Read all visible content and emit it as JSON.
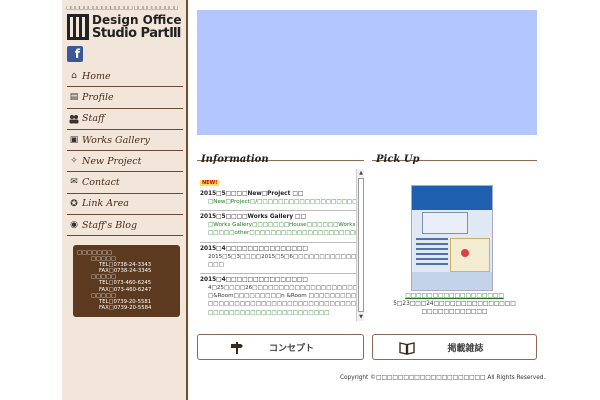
{
  "sidebar": {
    "tagline": "□□□□□□□□□□□□□□□ □□□□□□□□□□",
    "logo_line1": "Design Office",
    "logo_line2": "Studio PartⅢ",
    "facebook_label": "f",
    "nav": [
      {
        "label": "Home",
        "icon": "home-icon",
        "glyph": "⌂"
      },
      {
        "label": "Profile",
        "icon": "profile-card-icon",
        "glyph": "▤"
      },
      {
        "label": "Staff",
        "icon": "people-icon",
        "glyph": "👥"
      },
      {
        "label": "Works Gallery",
        "icon": "gallery-icon",
        "glyph": "▣"
      },
      {
        "label": "New Project",
        "icon": "magic-wand-icon",
        "glyph": "✧"
      },
      {
        "label": "Contact",
        "icon": "mail-icon",
        "glyph": "✉"
      },
      {
        "label": "Link Area",
        "icon": "ribbon-icon",
        "glyph": "✪"
      },
      {
        "label": "Staff's Blog",
        "icon": "rss-icon",
        "glyph": "◉"
      }
    ],
    "address": {
      "heading": "□□□□□□□",
      "office1": "□□□□□",
      "tel1": "TEL□0738-24-3343",
      "fax1": "FAX□0738-24-3345",
      "office2": "□□□□□",
      "tel2": "TEL□073-460-6245",
      "fax2": "FAX□073-460-6247",
      "office3": "□□□□□",
      "tel3": "TEL□0739-20-5581",
      "fax3": "FAX□0739-20-5584"
    }
  },
  "info": {
    "heading": "Information",
    "new_badge": "NEW!",
    "entries": [
      {
        "title": "2015□5□□□□New□Project □□",
        "lines": [
          "□New□Project□/□□□□□□□□□□□□□□□□□□□□□□□□□□□□"
        ]
      },
      {
        "title": "2015□5□□□□Works Gallery □□",
        "lines": [
          "□Works Gallery□□□□□□□House□□□□□□Works Gallery□□",
          "□□□□□other□□□□□□□□□□□□□□□□□□□□□□□□□□□□□□□□"
        ]
      },
      {
        "title": "2015□4□□□□□□□□□□□□□□□",
        "lines": [
          "2015□5□3□□□□2015□5□6□□□□□□□□□□□□□□□□□□□□□□□",
          "□□□"
        ]
      },
      {
        "title": "2015□4□□□□□□□□□□□□□□□",
        "lines": [
          "4□25□□□□26□□□□□□□□□□□□□□□□□□□□□□□□□□□□□",
          "□&Room□□□□□□□□□n &Room □□□□□□□□□□□□□□□□□□□",
          "□□□□□□□□□□□□□□□□□□□□□□□□□□□□□□□□□□□□□□",
          "□□□□□□□□□□□□□□□□□□□□□□□"
        ]
      }
    ]
  },
  "pickup": {
    "heading": "Pick Up",
    "caption_link": "□□□□□□□□□□□□□□□□□□",
    "caption_line2": "5□23□□□24□□□□□□□□□□□□□□□",
    "caption_line3": "□□□□□□□□□□□□"
  },
  "buttons": {
    "concept": "コンセプト",
    "magazine": "掲載雑誌"
  },
  "footer": {
    "copyright": "Copyright ©□□□□□□□□□□□□□□□□□□□□ All Rights Reserved."
  },
  "colors": {
    "sidebar_bg": "#f2e6da",
    "accent_brown": "#5c3a20",
    "banner_blue": "#b4c6ff",
    "link_green": "#1a7a1a"
  }
}
